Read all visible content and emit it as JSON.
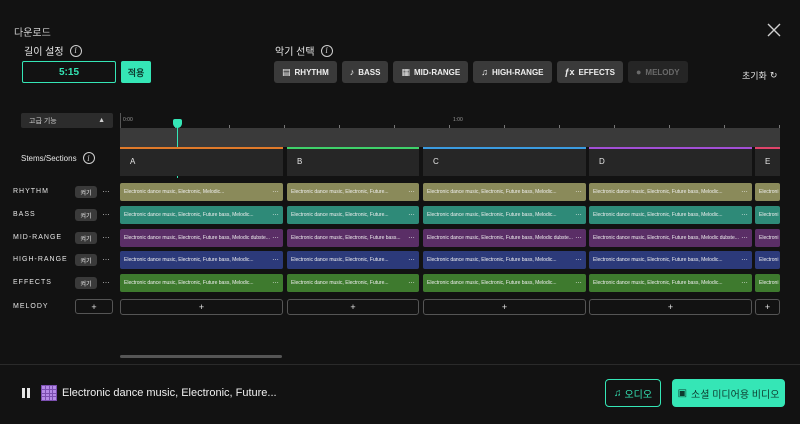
{
  "header": {
    "title": "다운로드"
  },
  "length": {
    "label": "길이 설정",
    "value": "5:15",
    "apply_label": "적용"
  },
  "instruments": {
    "label": "악기 선택",
    "items": [
      {
        "label": "RHYTHM",
        "icon": "drum-icon",
        "enabled": true
      },
      {
        "label": "BASS",
        "icon": "guitar-icon",
        "enabled": true
      },
      {
        "label": "MID-RANGE",
        "icon": "piano-icon",
        "enabled": true
      },
      {
        "label": "HIGH-RANGE",
        "icon": "violin-icon",
        "enabled": true
      },
      {
        "label": "EFFECTS",
        "icon": "fx-icon",
        "enabled": true
      },
      {
        "label": "MELODY",
        "icon": "mic-icon",
        "enabled": false
      }
    ],
    "reset_label": "초기화"
  },
  "advanced": {
    "label": "고급 기능"
  },
  "timeline": {
    "time_labels": [
      "0:00",
      "1:00"
    ],
    "stems_label": "Stems/Sections"
  },
  "sections": [
    {
      "label": "A",
      "color": "#e07a2a"
    },
    {
      "label": "B",
      "color": "#3fd16a"
    },
    {
      "label": "C",
      "color": "#3b9be0"
    },
    {
      "label": "D",
      "color": "#a24fd6"
    },
    {
      "label": "E",
      "color": "#e0446a"
    }
  ],
  "rows": [
    {
      "label": "RHYTHM",
      "toggle": "켜기",
      "color": "#8a8a5a",
      "clips": [
        "Electronic dance music, Electronic, Melodic...",
        "Electronic dance music, Electronic, Future...",
        "Electronic dance music, Electronic, Future bass, Melodic...",
        "Electronic dance music, Electronic, Future bass, Melodic...",
        "Electroni"
      ]
    },
    {
      "label": "BASS",
      "toggle": "켜기",
      "color": "#2e8a78",
      "clips": [
        "Electronic dance music, Electronic, Future bass, Melodic...",
        "Electronic dance music, Electronic, Future...",
        "Electronic dance music, Electronic, Future bass, Melodic...",
        "Electronic dance music, Electronic, Future bass, Melodic...",
        "Electroni"
      ]
    },
    {
      "label": "MID-RANGE",
      "toggle": "켜기",
      "color": "#5a2e66",
      "clips": [
        "Electronic dance music, Electronic, Future bass, Melodic dubste...",
        "Electronic dance music, Electronic, Future bass...",
        "Electronic dance music, Electronic, Future bass, Melodic dubste...",
        "Electronic dance music, Electronic, Future bass, Melodic dubste...",
        "Electroni"
      ]
    },
    {
      "label": "HIGH-RANGE",
      "toggle": "켜기",
      "color": "#2c3a7a",
      "clips": [
        "Electronic dance music, Electronic, Future bass, Melodic...",
        "Electronic dance music, Electronic, Future...",
        "Electronic dance music, Electronic, Future bass, Melodic...",
        "Electronic dance music, Electronic, Future bass, Melodic...",
        "Electroni"
      ]
    },
    {
      "label": "EFFECTS",
      "toggle": "켜기",
      "color": "#3e7a2e",
      "clips": [
        "Electronic dance music, Electronic, Future bass, Melodic...",
        "Electronic dance music, Electronic, Future...",
        "Electronic dance music, Electronic, Future bass, Melodic...",
        "Electronic dance music, Electronic, Future bass, Melodic...",
        "Electroni"
      ]
    },
    {
      "label": "MELODY",
      "toggle": "+",
      "color": "",
      "clips": [
        "+",
        "+",
        "+",
        "+",
        "+"
      ]
    }
  ],
  "player": {
    "track_title": "Electronic dance music, Electronic, Future...",
    "audio_label": "오디오",
    "video_label": "소셜 미디어용 비디오"
  }
}
